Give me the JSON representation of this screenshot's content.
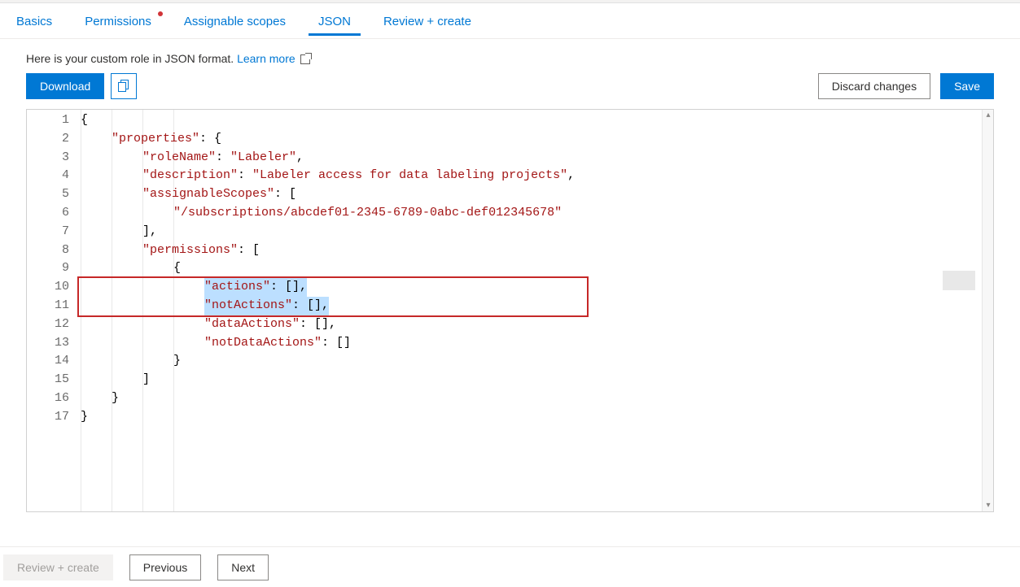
{
  "tabs": {
    "basics": "Basics",
    "permissions": "Permissions",
    "assignable": "Assignable scopes",
    "json": "JSON",
    "review": "Review + create",
    "active": "json",
    "dot_on": "permissions"
  },
  "subhead": {
    "text": "Here is your custom role in JSON format. ",
    "link": "Learn more"
  },
  "toolbar": {
    "download": "Download",
    "discard": "Discard changes",
    "save": "Save",
    "copy_icon": "copy"
  },
  "code": {
    "lines": [
      {
        "n": 1,
        "indent": 0,
        "tokens": [
          {
            "t": "punct",
            "v": "{"
          }
        ]
      },
      {
        "n": 2,
        "indent": 1,
        "tokens": [
          {
            "t": "key",
            "v": "\"properties\""
          },
          {
            "t": "punct",
            "v": ": {"
          }
        ]
      },
      {
        "n": 3,
        "indent": 2,
        "tokens": [
          {
            "t": "key",
            "v": "\"roleName\""
          },
          {
            "t": "punct",
            "v": ": "
          },
          {
            "t": "string",
            "v": "\"Labeler\""
          },
          {
            "t": "punct",
            "v": ","
          }
        ]
      },
      {
        "n": 4,
        "indent": 2,
        "tokens": [
          {
            "t": "key",
            "v": "\"description\""
          },
          {
            "t": "punct",
            "v": ": "
          },
          {
            "t": "string",
            "v": "\"Labeler access for data labeling projects\""
          },
          {
            "t": "punct",
            "v": ","
          }
        ]
      },
      {
        "n": 5,
        "indent": 2,
        "tokens": [
          {
            "t": "key",
            "v": "\"assignableScopes\""
          },
          {
            "t": "punct",
            "v": ": ["
          }
        ]
      },
      {
        "n": 6,
        "indent": 3,
        "tokens": [
          {
            "t": "string",
            "v": "\"/subscriptions/abcdef01-2345-6789-0abc-def012345678\""
          }
        ]
      },
      {
        "n": 7,
        "indent": 2,
        "tokens": [
          {
            "t": "punct",
            "v": "],"
          }
        ]
      },
      {
        "n": 8,
        "indent": 2,
        "tokens": [
          {
            "t": "key",
            "v": "\"permissions\""
          },
          {
            "t": "punct",
            "v": ": ["
          }
        ]
      },
      {
        "n": 9,
        "indent": 3,
        "tokens": [
          {
            "t": "punct",
            "v": "{"
          }
        ]
      },
      {
        "n": 10,
        "indent": 4,
        "highlighted": true,
        "tokens": [
          {
            "t": "key",
            "v": "\"actions\""
          },
          {
            "t": "punct",
            "v": ": [],"
          }
        ]
      },
      {
        "n": 11,
        "indent": 4,
        "highlighted": true,
        "tokens": [
          {
            "t": "key",
            "v": "\"notActions\""
          },
          {
            "t": "punct",
            "v": ": [],"
          }
        ]
      },
      {
        "n": 12,
        "indent": 4,
        "tokens": [
          {
            "t": "key",
            "v": "\"dataActions\""
          },
          {
            "t": "punct",
            "v": ": [],"
          }
        ]
      },
      {
        "n": 13,
        "indent": 4,
        "tokens": [
          {
            "t": "key",
            "v": "\"notDataActions\""
          },
          {
            "t": "punct",
            "v": ": []"
          }
        ]
      },
      {
        "n": 14,
        "indent": 3,
        "tokens": [
          {
            "t": "punct",
            "v": "}"
          }
        ]
      },
      {
        "n": 15,
        "indent": 2,
        "tokens": [
          {
            "t": "punct",
            "v": "]"
          }
        ]
      },
      {
        "n": 16,
        "indent": 1,
        "tokens": [
          {
            "t": "punct",
            "v": "}"
          }
        ]
      },
      {
        "n": 17,
        "indent": 0,
        "tokens": [
          {
            "t": "punct",
            "v": "}"
          }
        ]
      }
    ],
    "highlight_rows": [
      10,
      11
    ]
  },
  "footer": {
    "review": "Review + create",
    "previous": "Previous",
    "next": "Next"
  }
}
